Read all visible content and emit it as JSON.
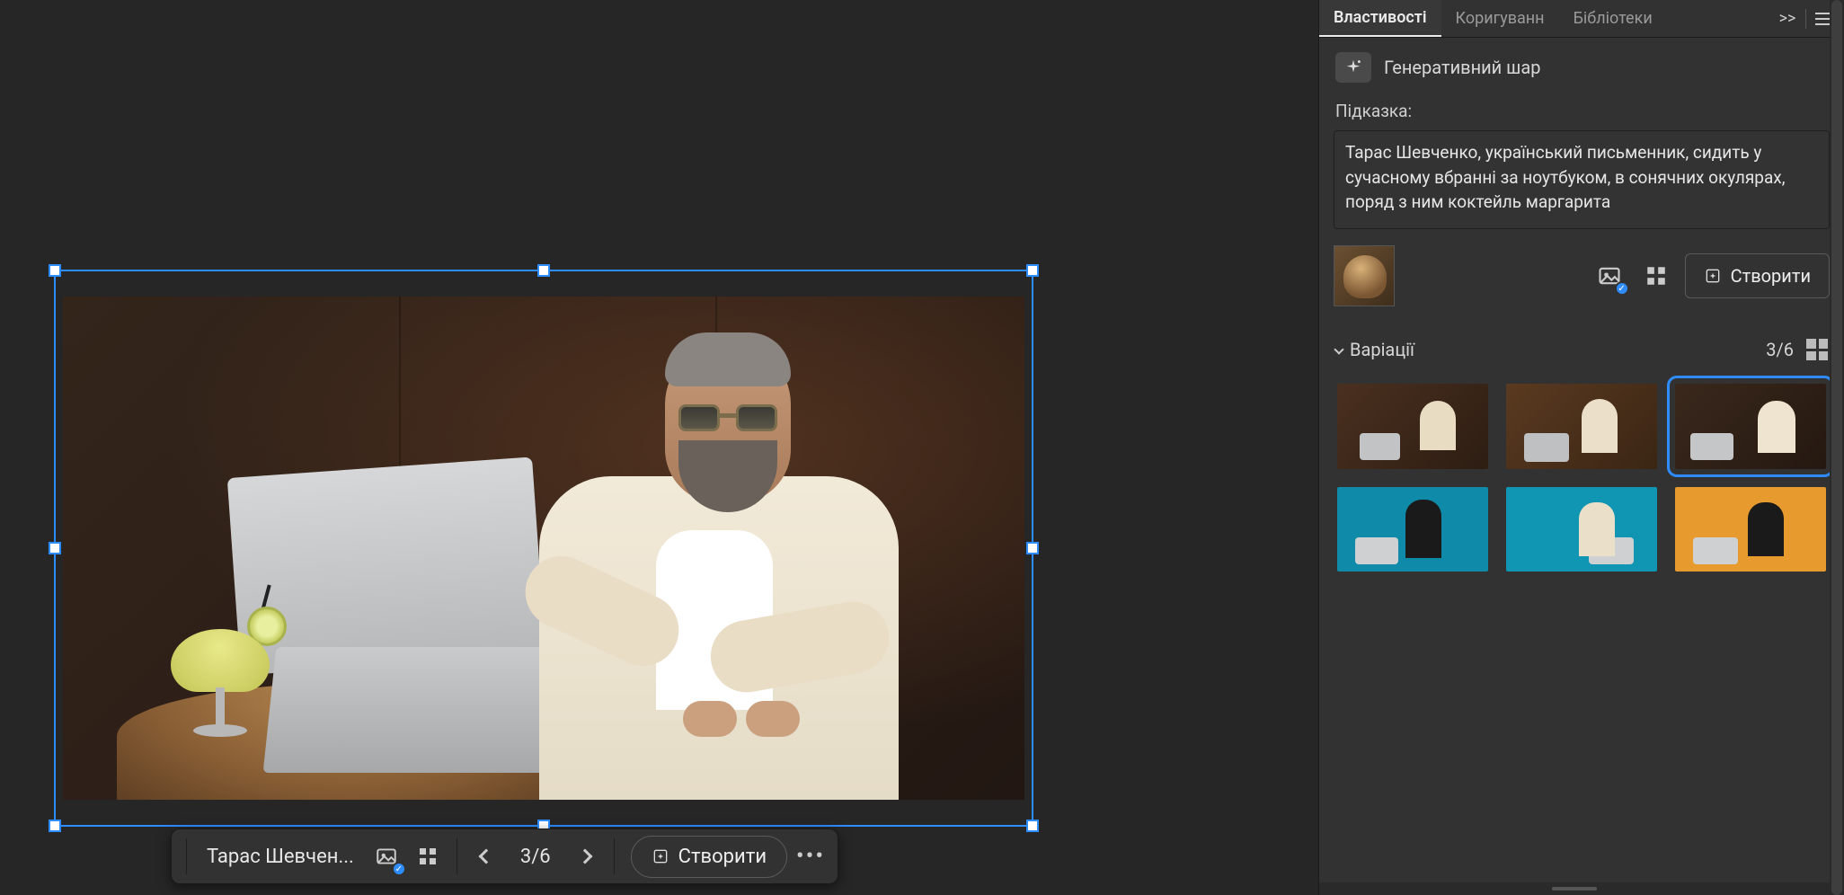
{
  "panel": {
    "tabs": {
      "properties": "Властивості",
      "adjust": "Коригуванн",
      "libraries": "Бібліотеки"
    },
    "layer_type": "Генеративний шар",
    "prompt_label": "Підказка:",
    "prompt_text": " Тарас Шевченко, український письменник, сидить у сучасному вбранні за ноутбуком, в сонячних окулярах, поряд з ним коктейль маргарита",
    "create_label": "Створити",
    "variations_label": "Варіації",
    "variations_counter": "3/6"
  },
  "taskbar": {
    "prompt_truncated": "Тарас Шевчен...",
    "counter": "3/6",
    "create_label": "Створити"
  },
  "icons": {
    "sparkle": "✦",
    "check": "✓"
  }
}
